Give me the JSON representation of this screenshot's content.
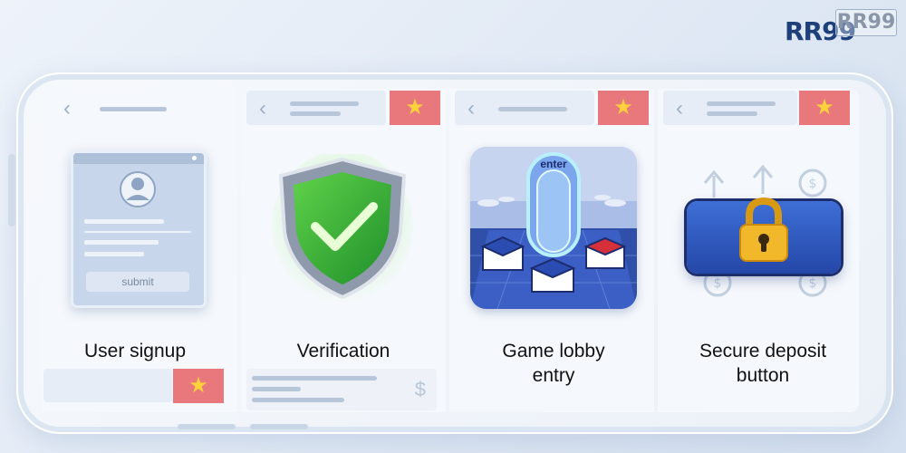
{
  "brand": {
    "logo_text": "RR99",
    "ghost_text": "RR99"
  },
  "flag_icon": "vietnam-flag-icon",
  "steps": [
    {
      "title": "User signup",
      "illustration": "signup-form",
      "submit_label": "submit"
    },
    {
      "title": "Verification",
      "illustration": "shield-check-icon"
    },
    {
      "title_line1": "Game lobby",
      "title_line2": "entry",
      "enter_label": "enter",
      "illustration": "lobby-portal"
    },
    {
      "title_line1": "Secure deposit",
      "title_line2": "button",
      "illustration": "padlock-icon"
    }
  ],
  "colors": {
    "flag_red": "#e8787c",
    "star_yellow": "#ffd23c",
    "shield_green": "#3dbb3d",
    "deposit_blue": "#2f58c4",
    "lock_gold": "#f2b82b"
  }
}
